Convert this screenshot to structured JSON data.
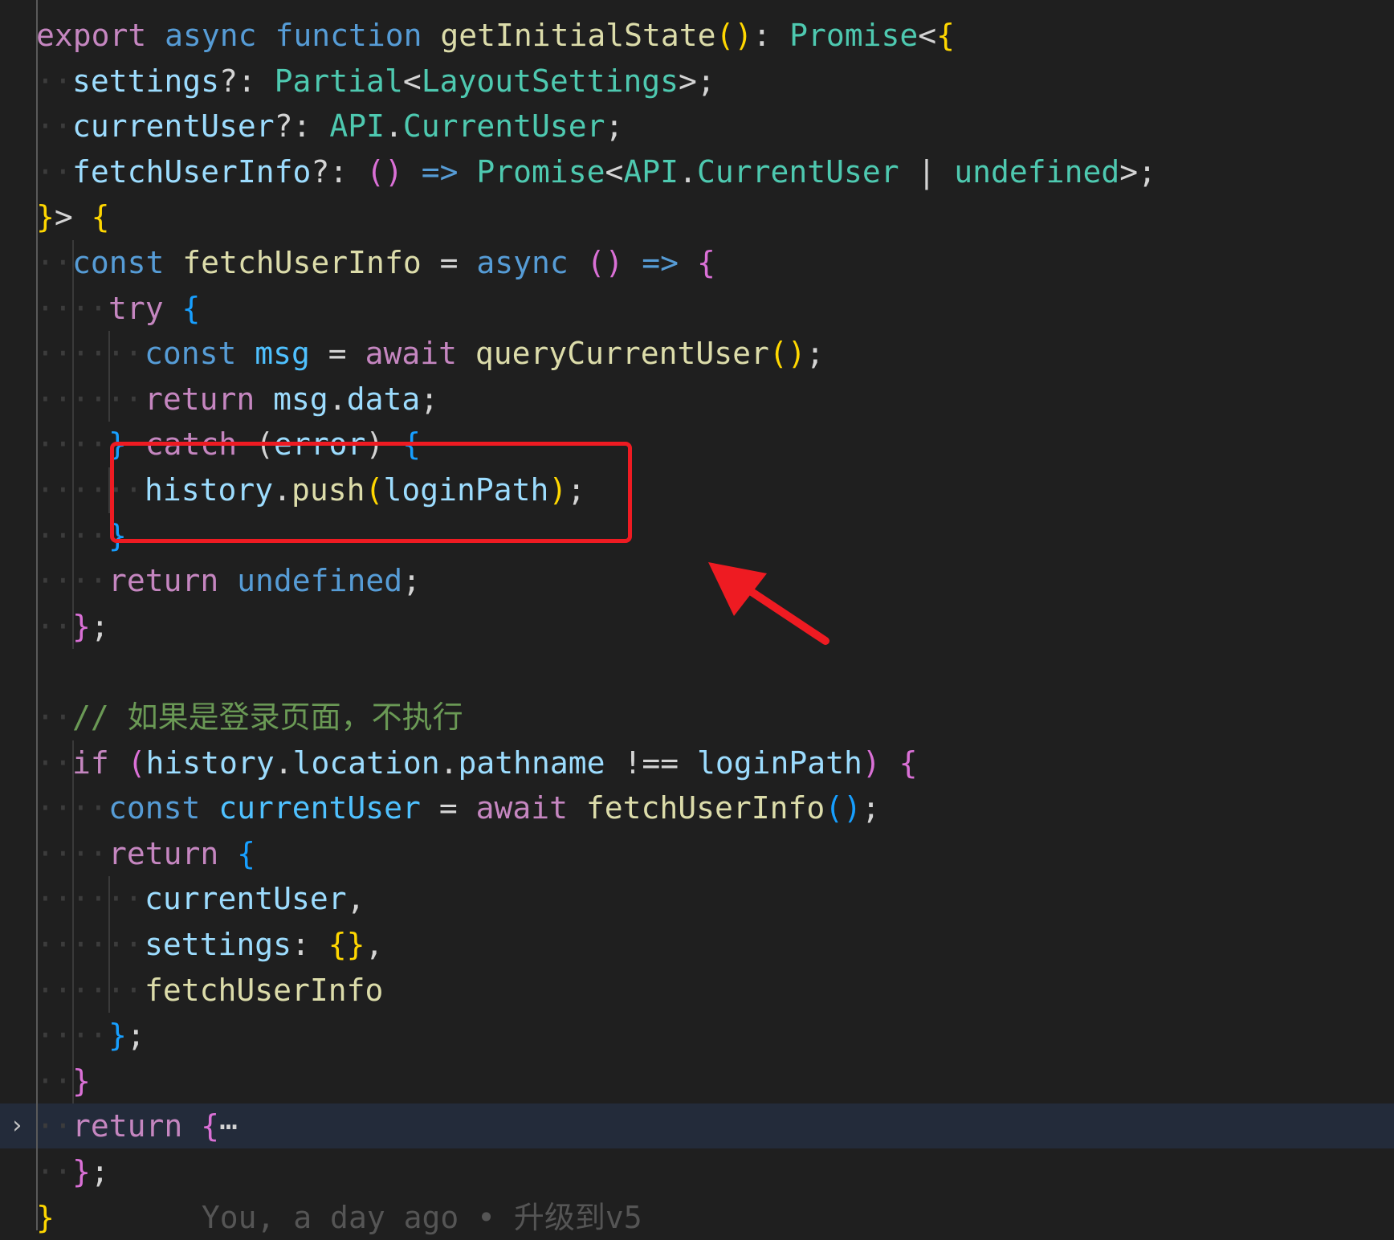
{
  "editor": {
    "lines": [
      {
        "indent": 0,
        "tokens": [
          [
            "kw",
            "export"
          ],
          [
            "ws",
            " "
          ],
          [
            "st",
            "async"
          ],
          [
            "ws",
            " "
          ],
          [
            "st",
            "function"
          ],
          [
            "ws",
            " "
          ],
          [
            "fn",
            "getInitialState"
          ],
          [
            "b1",
            "()"
          ],
          [
            "pl",
            ": "
          ],
          [
            "ty",
            "Promise"
          ],
          [
            "pl",
            "<"
          ],
          [
            "b1",
            "{"
          ]
        ]
      },
      {
        "indent": 1,
        "tokens": [
          [
            "vr",
            "settings"
          ],
          [
            "pl",
            "?: "
          ],
          [
            "ty",
            "Partial"
          ],
          [
            "pl",
            "<"
          ],
          [
            "ty",
            "LayoutSettings"
          ],
          [
            "pl",
            ">;"
          ]
        ]
      },
      {
        "indent": 1,
        "tokens": [
          [
            "vr",
            "currentUser"
          ],
          [
            "pl",
            "?: "
          ],
          [
            "ty",
            "API"
          ],
          [
            "pl",
            "."
          ],
          [
            "ty",
            "CurrentUser"
          ],
          [
            "pl",
            ";"
          ]
        ]
      },
      {
        "indent": 1,
        "tokens": [
          [
            "vr",
            "fetchUserInfo"
          ],
          [
            "pl",
            "?: "
          ],
          [
            "b2",
            "()"
          ],
          [
            "ws",
            " "
          ],
          [
            "st",
            "=>"
          ],
          [
            "ws",
            " "
          ],
          [
            "ty",
            "Promise"
          ],
          [
            "pl",
            "<"
          ],
          [
            "ty",
            "API"
          ],
          [
            "pl",
            "."
          ],
          [
            "ty",
            "CurrentUser"
          ],
          [
            "ws",
            " "
          ],
          [
            "pl",
            "|"
          ],
          [
            "ws",
            " "
          ],
          [
            "ty",
            "undefined"
          ],
          [
            "pl",
            ">;"
          ]
        ]
      },
      {
        "indent": 0,
        "tokens": [
          [
            "b1",
            "}"
          ],
          [
            "pl",
            "> "
          ],
          [
            "b1",
            "{"
          ]
        ]
      },
      {
        "indent": 1,
        "tokens": [
          [
            "st",
            "const"
          ],
          [
            "ws",
            " "
          ],
          [
            "fn",
            "fetchUserInfo"
          ],
          [
            "pl",
            " = "
          ],
          [
            "st",
            "async"
          ],
          [
            "ws",
            " "
          ],
          [
            "b2",
            "()"
          ],
          [
            "ws",
            " "
          ],
          [
            "st",
            "=>"
          ],
          [
            "ws",
            " "
          ],
          [
            "b2",
            "{"
          ]
        ]
      },
      {
        "indent": 2,
        "tokens": [
          [
            "kw",
            "try"
          ],
          [
            "ws",
            " "
          ],
          [
            "b3",
            "{"
          ]
        ]
      },
      {
        "indent": 3,
        "tokens": [
          [
            "st",
            "const"
          ],
          [
            "ws",
            " "
          ],
          [
            "cst",
            "msg"
          ],
          [
            "pl",
            " = "
          ],
          [
            "kw",
            "await"
          ],
          [
            "ws",
            " "
          ],
          [
            "fn",
            "queryCurrentUser"
          ],
          [
            "b1",
            "()"
          ],
          [
            "pl",
            ";"
          ]
        ]
      },
      {
        "indent": 3,
        "tokens": [
          [
            "kw",
            "return"
          ],
          [
            "ws",
            " "
          ],
          [
            "vr",
            "msg"
          ],
          [
            "pl",
            "."
          ],
          [
            "vr",
            "data"
          ],
          [
            "pl",
            ";"
          ]
        ]
      },
      {
        "indent": 2,
        "tokens": [
          [
            "b3",
            "}"
          ],
          [
            "ws",
            " "
          ],
          [
            "kw",
            "catch"
          ],
          [
            "ws",
            " "
          ],
          [
            "pl",
            "("
          ],
          [
            "vr",
            "error"
          ],
          [
            "pl",
            ")"
          ],
          [
            "ws",
            " "
          ],
          [
            "b3",
            "{"
          ]
        ]
      },
      {
        "indent": 3,
        "tokens": [
          [
            "vr",
            "history"
          ],
          [
            "pl",
            "."
          ],
          [
            "fn",
            "push"
          ],
          [
            "b1",
            "("
          ],
          [
            "vr",
            "loginPath"
          ],
          [
            "b1",
            ")"
          ],
          [
            "pl",
            ";"
          ]
        ]
      },
      {
        "indent": 2,
        "tokens": [
          [
            "b3",
            "}"
          ]
        ]
      },
      {
        "indent": 2,
        "tokens": [
          [
            "kw",
            "return"
          ],
          [
            "ws",
            " "
          ],
          [
            "st",
            "undefined"
          ],
          [
            "pl",
            ";"
          ]
        ]
      },
      {
        "indent": 1,
        "tokens": [
          [
            "b2",
            "}"
          ],
          [
            "pl",
            ";"
          ]
        ]
      },
      {
        "indent": 0,
        "tokens": []
      },
      {
        "indent": 1,
        "tokens": [
          [
            "cm",
            "// 如果是登录页面，不执行"
          ]
        ]
      },
      {
        "indent": 1,
        "tokens": [
          [
            "kw",
            "if"
          ],
          [
            "ws",
            " "
          ],
          [
            "b2",
            "("
          ],
          [
            "vr",
            "history"
          ],
          [
            "pl",
            "."
          ],
          [
            "vr",
            "location"
          ],
          [
            "pl",
            "."
          ],
          [
            "vr",
            "pathname"
          ],
          [
            "ws",
            " "
          ],
          [
            "pl",
            "!=="
          ],
          [
            "ws",
            " "
          ],
          [
            "vr",
            "loginPath"
          ],
          [
            "b2",
            ")"
          ],
          [
            "ws",
            " "
          ],
          [
            "b2",
            "{"
          ]
        ]
      },
      {
        "indent": 2,
        "tokens": [
          [
            "st",
            "const"
          ],
          [
            "ws",
            " "
          ],
          [
            "cst",
            "currentUser"
          ],
          [
            "pl",
            " = "
          ],
          [
            "kw",
            "await"
          ],
          [
            "ws",
            " "
          ],
          [
            "fn",
            "fetchUserInfo"
          ],
          [
            "b3",
            "()"
          ],
          [
            "pl",
            ";"
          ]
        ]
      },
      {
        "indent": 2,
        "tokens": [
          [
            "kw",
            "return"
          ],
          [
            "ws",
            " "
          ],
          [
            "b3",
            "{"
          ]
        ]
      },
      {
        "indent": 3,
        "tokens": [
          [
            "vr",
            "currentUser"
          ],
          [
            "pl",
            ","
          ]
        ]
      },
      {
        "indent": 3,
        "tokens": [
          [
            "vr",
            "settings"
          ],
          [
            "pl",
            ": "
          ],
          [
            "b1",
            "{}"
          ],
          [
            "pl",
            ","
          ]
        ]
      },
      {
        "indent": 3,
        "tokens": [
          [
            "fn",
            "fetchUserInfo"
          ]
        ]
      },
      {
        "indent": 2,
        "tokens": [
          [
            "b3",
            "}"
          ],
          [
            "pl",
            ";"
          ]
        ]
      },
      {
        "indent": 1,
        "tokens": [
          [
            "b2",
            "}"
          ]
        ]
      },
      {
        "indent": 1,
        "folded": true,
        "tokens": [
          [
            "kw",
            "return"
          ],
          [
            "ws",
            " "
          ],
          [
            "b2",
            "{"
          ],
          [
            "pl",
            "⋯"
          ]
        ]
      },
      {
        "indent": 1,
        "tokens": [
          [
            "b2",
            "}"
          ],
          [
            "pl",
            ";"
          ]
        ]
      },
      {
        "indent": 0,
        "tokens": [
          [
            "b1",
            "}"
          ],
          [
            "blame",
            "        You, a day ago • 升级到v5"
          ]
        ]
      }
    ]
  },
  "colors": {
    "background": "#1f1f1f",
    "annotation": "#ee1b22"
  },
  "icons": {
    "fold_chevron": "chevron-right-icon",
    "annotation_arrow": "red-arrow-icon"
  }
}
